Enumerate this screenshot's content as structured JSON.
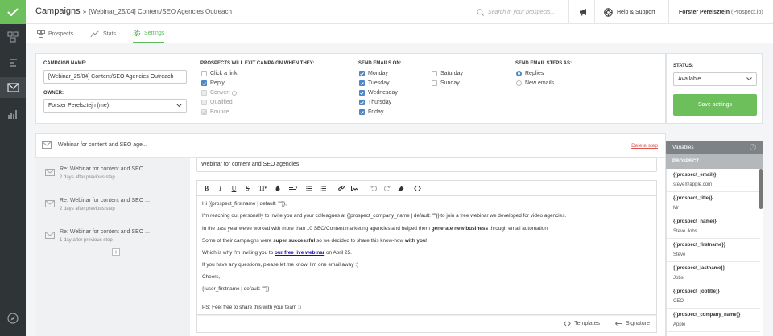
{
  "header": {
    "title": "Campaigns",
    "separator": "»",
    "subtitle": "[Webinar_25/04] Content/SEO Agencies Outreach",
    "search_placeholder": "Search in your prospects...",
    "help_label": "Help & Support",
    "user_name": "Forster Perelsztejn",
    "user_org": "(Prospect.io)"
  },
  "tabs": [
    {
      "label": "Prospects"
    },
    {
      "label": "Stats"
    },
    {
      "label": "Settings"
    }
  ],
  "settings": {
    "campaign_name_label": "CAMPAIGN NAME:",
    "campaign_name_value": "[Webinar_25/04] Content/SEO Agencies Outreach",
    "owner_label": "OWNER:",
    "owner_value": "Forster Perelsztejn (me)",
    "exit_label": "PROSPECTS WILL EXIT CAMPAIGN WHEN THEY:",
    "exit_options": [
      {
        "label": "Click a link",
        "checked": false,
        "disabled": false
      },
      {
        "label": "Reply",
        "checked": true,
        "disabled": false
      },
      {
        "label": "Convert",
        "checked": false,
        "disabled": true
      },
      {
        "label": "Qualified",
        "checked": false,
        "disabled": true
      },
      {
        "label": "Bounce",
        "checked": true,
        "disabled": true
      }
    ],
    "send_on_label": "SEND EMAILS ON:",
    "days_col1": [
      {
        "label": "Monday",
        "checked": true
      },
      {
        "label": "Tuesday",
        "checked": true
      },
      {
        "label": "Wednesday",
        "checked": true
      },
      {
        "label": "Thursday",
        "checked": true
      },
      {
        "label": "Friday",
        "checked": true
      }
    ],
    "days_col2": [
      {
        "label": "Saturday",
        "checked": false
      },
      {
        "label": "Sunday",
        "checked": false
      }
    ],
    "send_as_label": "SEND EMAIL STEPS AS:",
    "send_as_options": [
      {
        "label": "Replies",
        "selected": true
      },
      {
        "label": "New emails",
        "selected": false
      }
    ],
    "status_label": "STATUS:",
    "status_value": "Available",
    "save_label": "Save settings"
  },
  "sequence": {
    "main_step_title": "Webinar for content and SEO age...",
    "delete_label": "Delete step",
    "steps": [
      {
        "title": "Re: Webinar for content and SEO ...",
        "delay": "2 days after previous step"
      },
      {
        "title": "Re: Webinar for content and SEO ...",
        "delay": "2 days after previous step"
      },
      {
        "title": "Re: Webinar for content and SEO ...",
        "delay": "1 day after previous step"
      }
    ],
    "add_label": "+"
  },
  "editor": {
    "subject": "Webinar for content and SEO agencies",
    "toolbar": {
      "bold": "B",
      "italic": "I",
      "underline": "U",
      "strike": "S",
      "font_size": "TI"
    },
    "l1": "Hi {{prospect_firstname | default: \"\"}},",
    "l2": "I'm reaching out personally to invite you and your colleagues at {{prospect_company_name | default: \"\"}} to join a free webinar we developed for video agencies.",
    "l3a": "In the past year we've worked with more than 10 SEO/Content marketing agencies and helped them ",
    "l3b": "generate new business",
    "l3c": " through email automation!",
    "l4a": "Some of their campaigns were ",
    "l4b": "super successful",
    "l4c": " so we decided to share this know-how ",
    "l4d": "with you",
    "l4e": "!",
    "l5a": "Which is why I'm inviting you to ",
    "l5b": "our free live webinar",
    "l5c": " on April 25.",
    "l6": "If you have any questions, please let me know, I'm one email away :)",
    "l7": "Cheers,",
    "l8": "{{user_firstname | default: \"\"}}",
    "l9": "PS: Feel free to share this with your team :)",
    "templates_label": "Templates",
    "signature_label": "Signature"
  },
  "variables": {
    "title": "Variables",
    "help": "?",
    "group": "PROSPECT",
    "items": [
      {
        "key": "{{prospect_email}}",
        "value": "steve@apple.com"
      },
      {
        "key": "{{prospect_title}}",
        "value": "Mr"
      },
      {
        "key": "{{prospect_name}}",
        "value": "Steve Jobs"
      },
      {
        "key": "{{prospect_firstname}}",
        "value": "Steve"
      },
      {
        "key": "{{prospect_lastname}}",
        "value": "Jobs"
      },
      {
        "key": "{{prospect_jobtitle}}",
        "value": "CEO"
      },
      {
        "key": "{{prospect_company_name}}",
        "value": "Apple"
      }
    ]
  },
  "colors": {
    "accent": "#6dbf5c",
    "sidebar": "#2f3437",
    "link": "#1a0dab",
    "delete": "#d9534f",
    "check": "#4f86c6"
  }
}
